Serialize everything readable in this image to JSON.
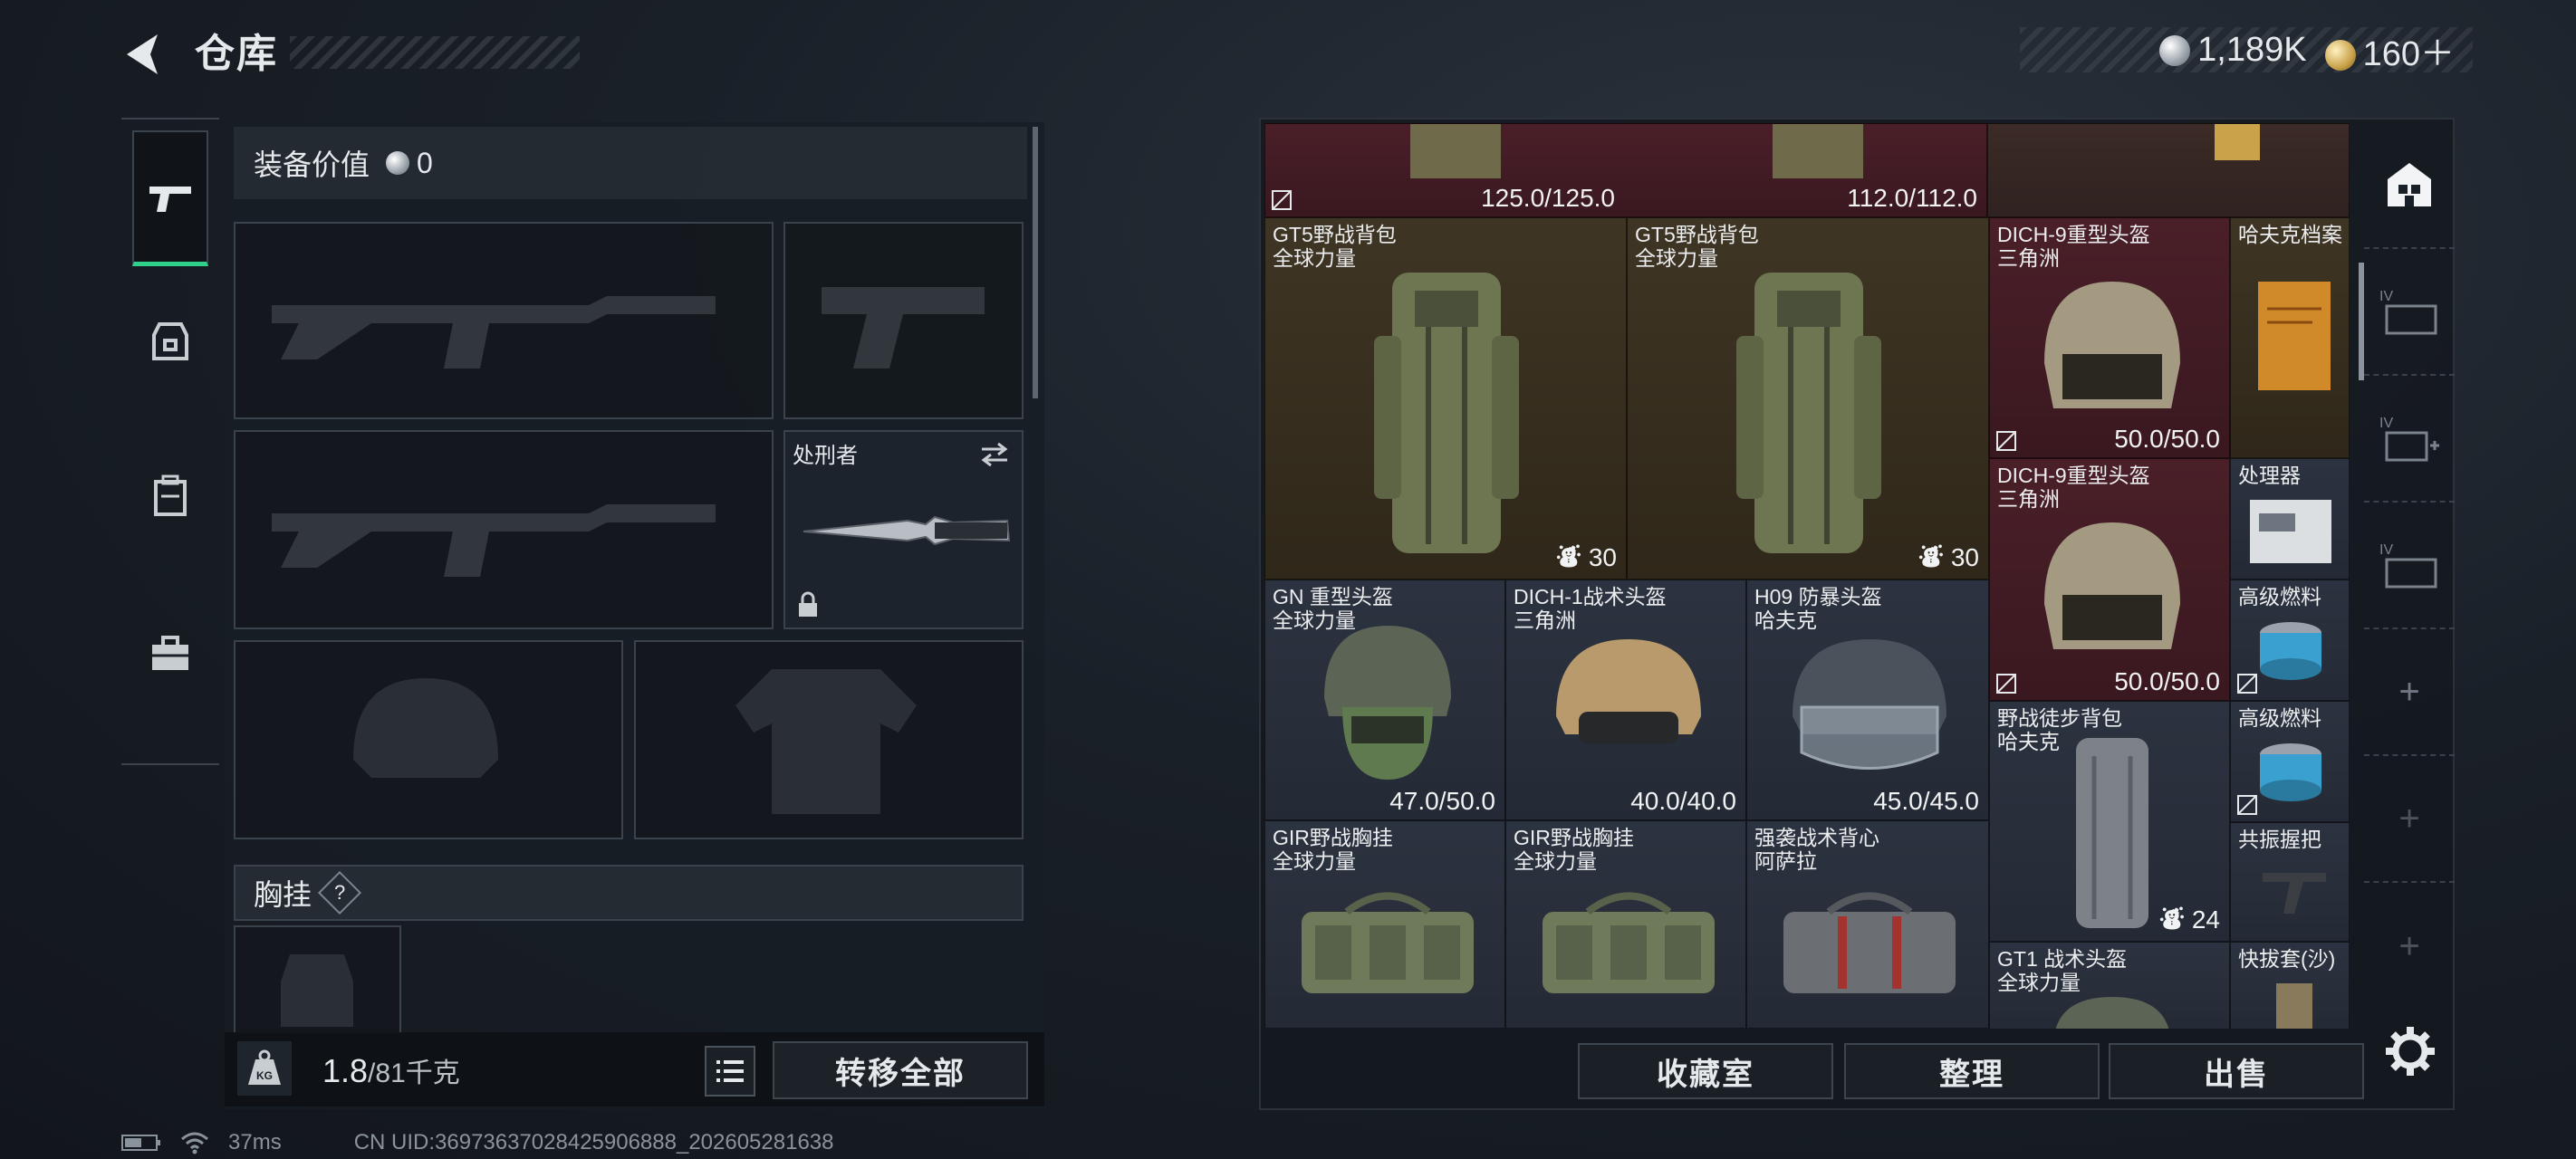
{
  "header": {
    "title": "仓库",
    "currency": [
      {
        "type": "silver",
        "value": "1,189K"
      },
      {
        "type": "gold",
        "value": "160＋"
      }
    ]
  },
  "left_rail": {
    "items": [
      "pistol-icon",
      "vest-icon",
      "backpack-icon",
      "toolbox-icon"
    ],
    "active": 0
  },
  "equipment": {
    "value_label": "装备价值",
    "value": "0",
    "knife": {
      "name": "处刑者"
    },
    "chest_rig_section": "胸挂",
    "chest_rig_help": "?",
    "weight_current": "1.8",
    "weight_max": "/81千克",
    "kg_label": "KG",
    "transfer_all": "转移全部"
  },
  "warehouse": {
    "items": [
      {
        "id": "top-left-bag",
        "name": "",
        "sub": "",
        "dur": "125.0/125.0",
        "bg": "red",
        "nodrop": true
      },
      {
        "id": "top-right-bag",
        "name": "",
        "sub": "",
        "dur": "112.0/112.0",
        "bg": "red",
        "nodrop": false
      },
      {
        "id": "gt5-a",
        "name": "GT5野战背包",
        "sub": "全球力量",
        "count": "30",
        "bg": "gold"
      },
      {
        "id": "gt5-b",
        "name": "GT5野战背包",
        "sub": "全球力量",
        "count": "30",
        "bg": "gold"
      },
      {
        "id": "dich9-a",
        "name": "DICH-9重型头盔",
        "sub": "三角洲",
        "dur": "50.0/50.0",
        "bg": "red",
        "nodrop": true
      },
      {
        "id": "hafk-file",
        "name": "哈夫克档案",
        "sub": "",
        "bg": "gold"
      },
      {
        "id": "dich9-b",
        "name": "DICH-9重型头盔",
        "sub": "三角洲",
        "dur": "50.0/50.0",
        "bg": "red",
        "nodrop": true
      },
      {
        "id": "processor",
        "name": "处理器",
        "sub": "",
        "bg": "blue"
      },
      {
        "id": "gn-helmet",
        "name": "GN 重型头盔",
        "sub": "全球力量",
        "dur": "47.0/50.0",
        "bg": "blue"
      },
      {
        "id": "dich1",
        "name": "DICH-1战术头盔",
        "sub": "三角洲",
        "dur": "40.0/40.0",
        "bg": "blue"
      },
      {
        "id": "h09",
        "name": "H09 防暴头盔",
        "sub": "哈夫克",
        "dur": "45.0/45.0",
        "bg": "blue"
      },
      {
        "id": "fuel-a",
        "name": "高级燃料",
        "sub": "",
        "bg": "blue",
        "nodrop": true
      },
      {
        "id": "hiking-bag",
        "name": "野战徒步背包",
        "sub": "哈夫克",
        "count": "24",
        "bg": "blue"
      },
      {
        "id": "fuel-b",
        "name": "高级燃料",
        "sub": "",
        "bg": "blue",
        "nodrop": true
      },
      {
        "id": "gir-a",
        "name": "GIR野战胸挂",
        "sub": "全球力量",
        "bg": "blue"
      },
      {
        "id": "gir-b",
        "name": "GIR野战胸挂",
        "sub": "全球力量",
        "bg": "blue"
      },
      {
        "id": "assault-vest",
        "name": "强袭战术背心",
        "sub": "阿萨拉",
        "bg": "blue"
      },
      {
        "id": "grip",
        "name": "共振握把",
        "sub": "",
        "bg": "blue"
      },
      {
        "id": "gt1",
        "name": "GT1 战术头盔",
        "sub": "全球力量",
        "bg": "blue"
      },
      {
        "id": "quick-holster",
        "name": "快拔套(沙)",
        "sub": "",
        "bg": "blue"
      }
    ],
    "buttons": {
      "collection": "收藏室",
      "organize": "整理",
      "sell": "出售"
    },
    "tab_labels": [
      "IV",
      "IV",
      "IV"
    ]
  },
  "status": {
    "ping": "37ms",
    "uid": "CN UID:3697363702842590688​8_202605281638"
  },
  "colors": {
    "accent": "#2fd08a",
    "red_rarity": "#4a1f28",
    "gold_rarity": "#3f3524",
    "blue_rarity": "#2c3340"
  }
}
